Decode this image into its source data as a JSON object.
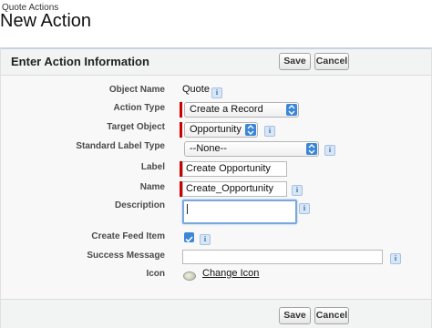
{
  "header": {
    "breadcrumb": "Quote Actions",
    "title": "New Action"
  },
  "panel": {
    "title": "Enter Action Information",
    "save_label": "Save",
    "cancel_label": "Cancel"
  },
  "fields": {
    "object_name": {
      "label": "Object Name",
      "value": "Quote"
    },
    "action_type": {
      "label": "Action Type",
      "value": "Create a Record"
    },
    "target_object": {
      "label": "Target Object",
      "value": "Opportunity"
    },
    "standard_label_type": {
      "label": "Standard Label Type",
      "value": "--None--"
    },
    "label": {
      "label": "Label",
      "value": "Create Opportunity"
    },
    "name": {
      "label": "Name",
      "value": "Create_Opportunity"
    },
    "description": {
      "label": "Description",
      "value": ""
    },
    "create_feed_item": {
      "label": "Create Feed Item",
      "checked": true
    },
    "success_message": {
      "label": "Success Message",
      "value": ""
    },
    "icon": {
      "label": "Icon",
      "link": "Change Icon"
    }
  },
  "info_glyph": "i",
  "colors": {
    "required": "#cc0000",
    "accent": "#3b86d6"
  }
}
